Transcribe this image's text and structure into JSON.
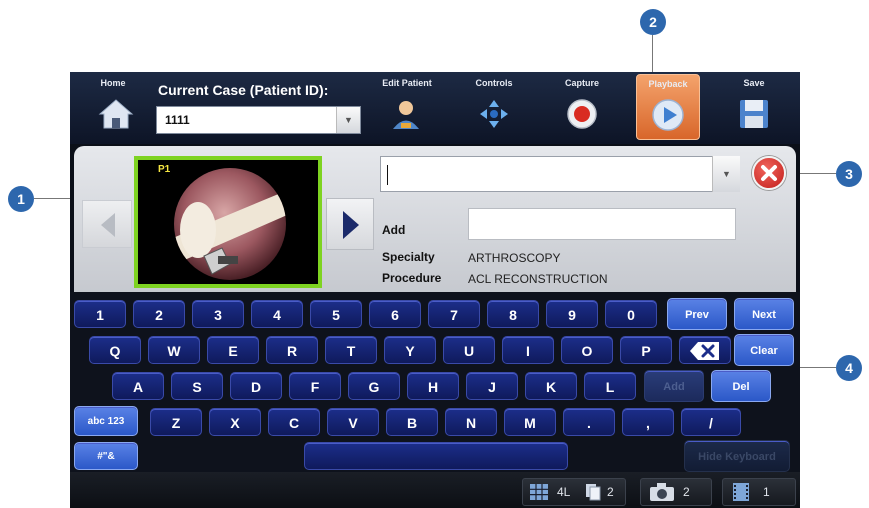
{
  "toolbar": {
    "home_label": "Home",
    "case_title": "Current Case (Patient ID):",
    "case_value": "1111",
    "edit_patient_label": "Edit Patient",
    "controls_label": "Controls",
    "capture_label": "Capture",
    "playback_label": "Playback",
    "save_label": "Save"
  },
  "thumbnail": {
    "label": "P1"
  },
  "form": {
    "search_value": "",
    "add_label": "Add",
    "add_value": "",
    "specialty_label": "Specialty",
    "specialty_value": "ARTHROSCOPY",
    "procedure_label": "Procedure",
    "procedure_value": "ACL RECONSTRUCTION"
  },
  "keyboard": {
    "row1": [
      "1",
      "2",
      "3",
      "4",
      "5",
      "6",
      "7",
      "8",
      "9",
      "0"
    ],
    "row2": [
      "Q",
      "W",
      "E",
      "R",
      "T",
      "Y",
      "U",
      "I",
      "O",
      "P"
    ],
    "row3": [
      "A",
      "S",
      "D",
      "F",
      "G",
      "H",
      "J",
      "K",
      "L"
    ],
    "row4": [
      "Z",
      "X",
      "C",
      "V",
      "B",
      "N",
      "M",
      ".",
      ",",
      "/"
    ],
    "prev": "Prev",
    "next": "Next",
    "clear": "Clear",
    "add": "Add",
    "del": "Del",
    "abc": "abc 123",
    "symbols": "#\"&",
    "hide": "Hide Keyboard"
  },
  "status": {
    "layout": "4L",
    "pages": "2",
    "photos": "2",
    "videos": "1"
  },
  "callouts": [
    "1",
    "2",
    "3",
    "4"
  ],
  "colors": {
    "accent_blue": "#2d67ad",
    "key_blue": "#1c2e8a",
    "playback_orange": "#e07a3c",
    "thumb_border": "#7ed321",
    "close_red": "#d22c26"
  }
}
